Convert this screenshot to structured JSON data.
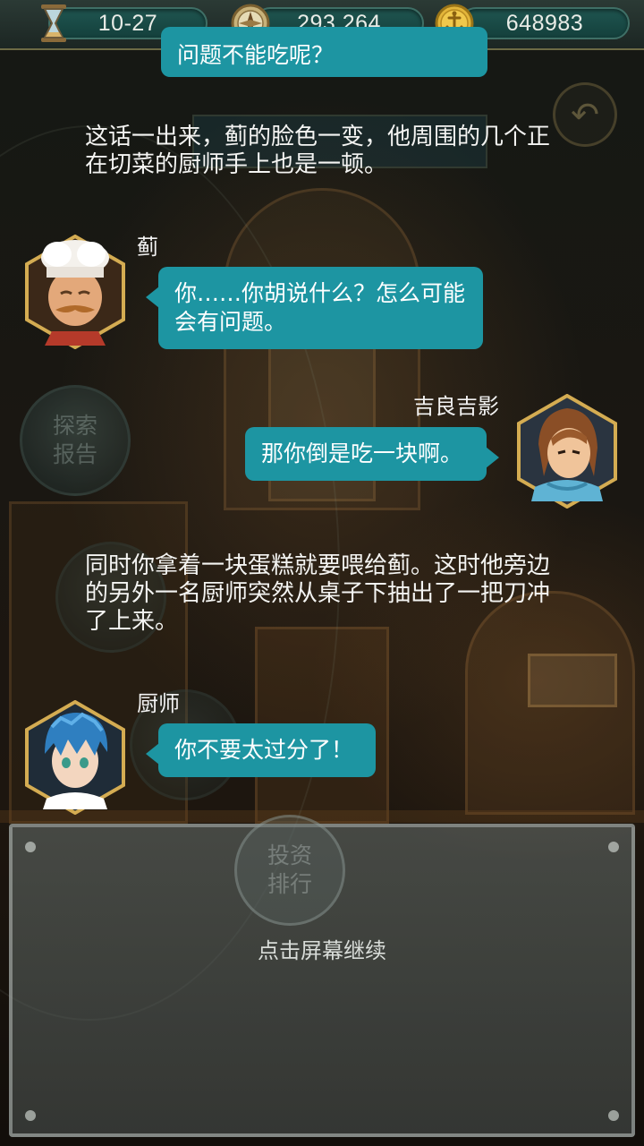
{
  "status_bar": {
    "time_value": "10-27",
    "compass_value": "293,264",
    "coin_value": "648983",
    "icons": [
      "hourglass-icon",
      "compass-icon",
      "anchor-coin-icon"
    ]
  },
  "background_menu": {
    "explore_report": "探索报告",
    "invest_rank": "投资排行",
    "back_icon": "back-arrow-icon"
  },
  "dialogue": {
    "top_bubble_cutoff": "问题不能吃呢？",
    "narration_1": "这话一出来，蓟的脸色一变，他周围的几个正在切菜的厨师手上也是一顿。",
    "speaker_1": "蓟",
    "line_1": "你……你胡说什么？怎么可能会有问题。",
    "speaker_2": "吉良吉影",
    "line_2": "那你倒是吃一块啊。",
    "narration_2": "同时你拿着一块蛋糕就要喂给蓟。这时他旁边的另外一名厨师突然从桌子下抽出了一把刀冲了上来。",
    "speaker_3": "厨师",
    "line_3": "你不要太过分了！"
  },
  "panel": {
    "continue_hint": "点击屏幕继续"
  },
  "colors": {
    "bubble": "#1d95a2",
    "frame_gold": "#c9a24e",
    "topbar": "#2b3a35"
  }
}
